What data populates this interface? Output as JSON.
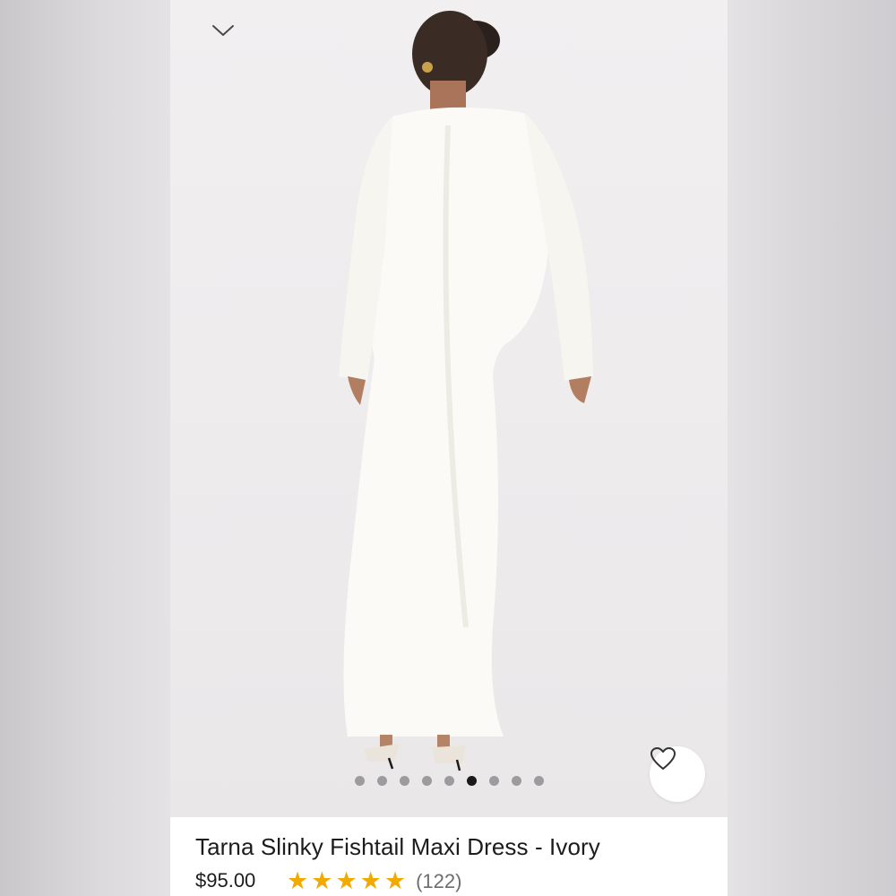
{
  "product": {
    "title": "Tarna Slinky Fishtail Maxi Dress - Ivory",
    "price": "$95.00",
    "rating": 5,
    "review_count": "(122)"
  },
  "gallery": {
    "total_images": 9,
    "active_index": 5
  },
  "icons": {
    "collapse": "chevron-down-icon",
    "favorite": "heart-icon",
    "star": "star-icon"
  },
  "colors": {
    "star": "#f2a900",
    "dot_active": "#1a1a1a",
    "dot_inactive": "#8f8d90"
  }
}
